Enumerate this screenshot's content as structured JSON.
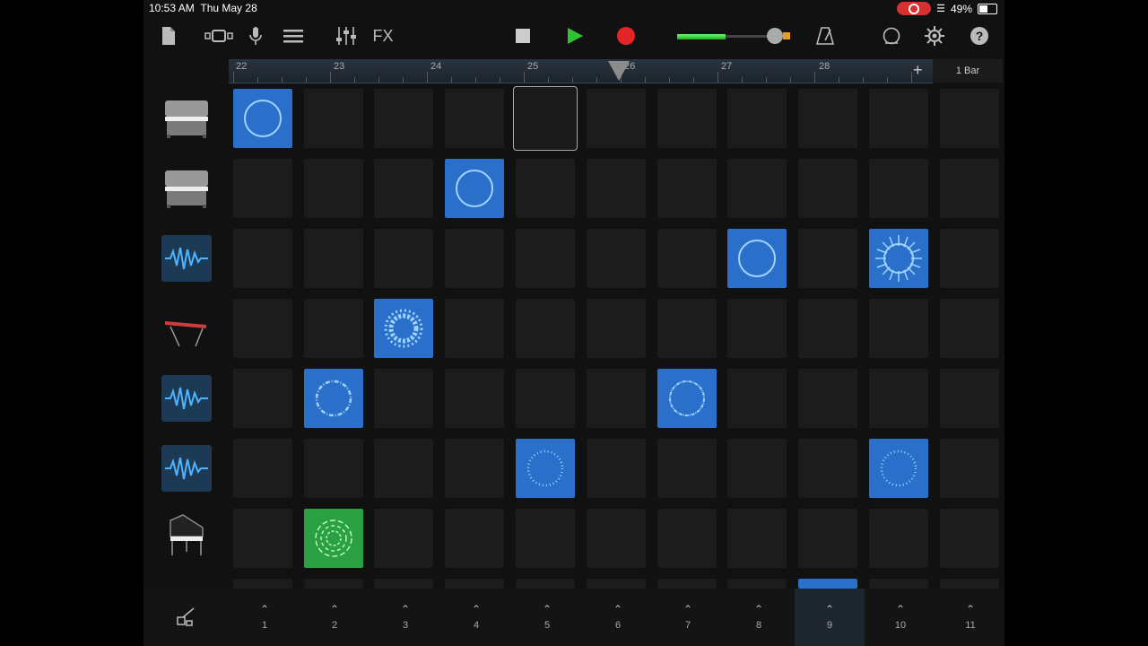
{
  "status": {
    "time": "10:53 AM",
    "date": "Thu May 28",
    "battery": "49%"
  },
  "toolbar": {
    "fx_label": "FX"
  },
  "ruler": {
    "bars": [
      "22",
      "23",
      "24",
      "25",
      "26",
      "27",
      "28"
    ],
    "bar_length": "1 Bar"
  },
  "tracks": [
    {
      "icon": "piano-icon"
    },
    {
      "icon": "piano-icon"
    },
    {
      "icon": "waveform-icon"
    },
    {
      "icon": "keyboard-icon"
    },
    {
      "icon": "waveform-icon"
    },
    {
      "icon": "waveform-icon"
    },
    {
      "icon": "grand-piano-icon"
    }
  ],
  "triggers": [
    "1",
    "2",
    "3",
    "4",
    "5",
    "6",
    "7",
    "8",
    "9",
    "10",
    "11"
  ],
  "colors": {
    "clip_blue": "#2a6fc9",
    "clip_green": "#2aa043",
    "play": "#2ec235",
    "record": "#e52525"
  }
}
